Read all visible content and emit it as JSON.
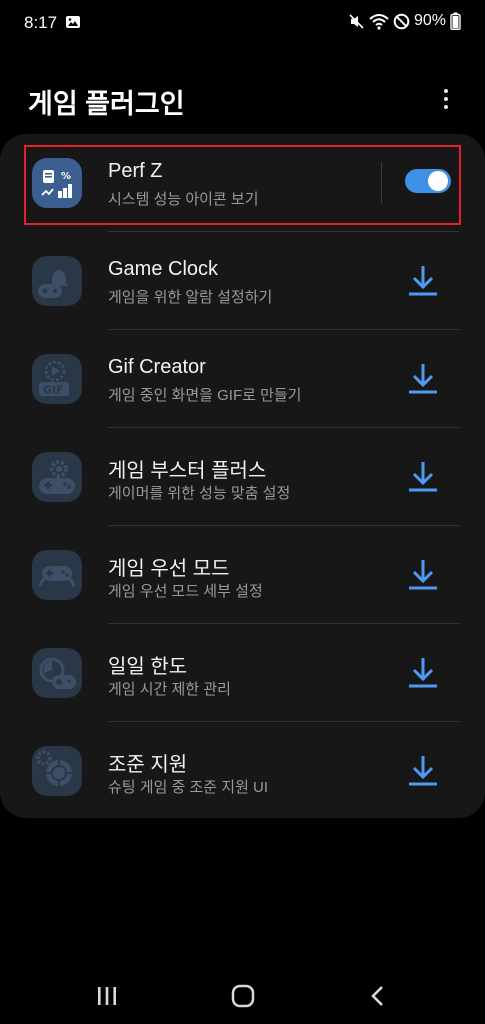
{
  "status_bar": {
    "time": "8:17",
    "battery": "90%",
    "icons": [
      "gallery-icon",
      "mute-icon",
      "wifi-icon",
      "do-not-disturb-icon",
      "battery-icon"
    ]
  },
  "header": {
    "title": "게임 플러그인",
    "more_icon": "more-vert-icon"
  },
  "plugins": [
    {
      "title": "Perf Z",
      "subtitle": "시스템 성능 아이콘 보기",
      "icon": "performance-chart-icon",
      "action": "toggle",
      "enabled": true,
      "highlighted": true
    },
    {
      "title": "Game Clock",
      "subtitle": "게임을 위한 알람 설정하기",
      "icon": "alarm-gamepad-icon",
      "action": "download"
    },
    {
      "title": "Gif Creator",
      "subtitle": "게임 중인 화면을 GIF로 만들기",
      "icon": "gif-icon",
      "action": "download"
    },
    {
      "title": "게임 부스터 플러스",
      "subtitle": "게이머를 위한 성능 맞춤 설정",
      "icon": "gear-gamepad-icon",
      "action": "download"
    },
    {
      "title": "게임 우선 모드",
      "subtitle": "게임 우선 모드 세부 설정",
      "icon": "gamepad-icon",
      "action": "download"
    },
    {
      "title": "일일 한도",
      "subtitle": "게임 시간 제한 관리",
      "icon": "timer-gamepad-icon",
      "action": "download"
    },
    {
      "title": "조준 지원",
      "subtitle": "슈팅 게임 중 조준 지원 UI",
      "icon": "crosshair-icon",
      "action": "download"
    }
  ],
  "nav_bar": {
    "items": [
      "recent-apps-icon",
      "home-icon",
      "back-icon"
    ]
  },
  "colors": {
    "background": "#000000",
    "card": "#171717",
    "accent": "#3e91e6",
    "highlight": "#e5202a",
    "icon_tile": "#2b3a4d"
  }
}
